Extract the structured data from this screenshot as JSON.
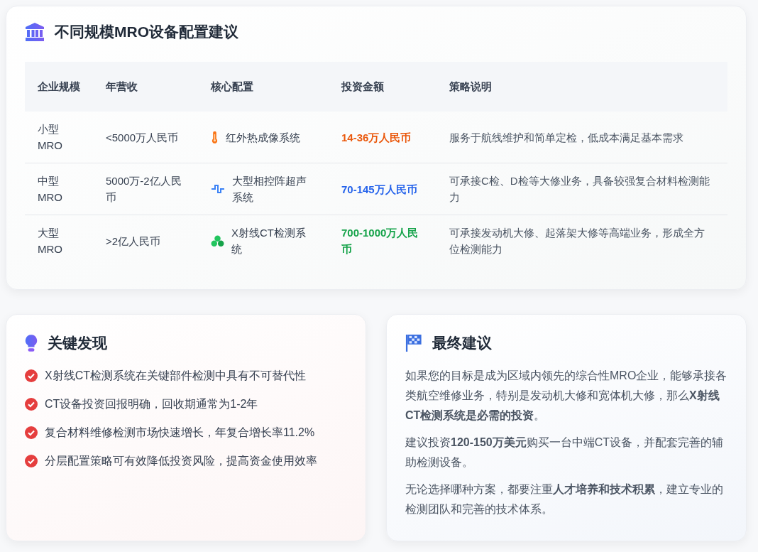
{
  "config_card": {
    "title": "不同规模MRO设备配置建议",
    "table": {
      "columns": [
        "企业规模",
        "年营收",
        "核心配置",
        "投资金额",
        "策略说明"
      ],
      "rows": [
        {
          "scale": "小型MRO",
          "revenue": "<5000万人民币",
          "config": "红外热成像系统",
          "amount": "14-36万人民币",
          "color": "#ea580c",
          "strategy": "服务于航线维护和简单定检，低成本满足基本需求"
        },
        {
          "scale": "中型MRO",
          "revenue": "5000万-2亿人民币",
          "config": "大型相控阵超声系统",
          "amount": "70-145万人民币",
          "color": "#2563eb",
          "strategy": "可承接C检、D检等大修业务，具备较强复合材料检测能力"
        },
        {
          "scale": "大型MRO",
          "revenue": ">2亿人民币",
          "config": "X射线CT检测系统",
          "amount": "700-1000万人民币",
          "color": "#16a34a",
          "strategy": "可承接发动机大修、起落架大修等高端业务，形成全方位检测能力"
        }
      ]
    }
  },
  "findings": {
    "title": "关键发现",
    "items": [
      "X射线CT检测系统在关键部件检测中具有不可替代性",
      "CT设备投资回报明确，回收期通常为1-2年",
      "复合材料维修检测市场快速增长，年复合增长率11.2%",
      "分层配置策略可有效降低投资风险，提高资金使用效率"
    ]
  },
  "recommendation": {
    "title": "最终建议",
    "paragraphs": [
      "如果您的目标是成为区域内领先的综合性MRO企业，能够承接各类航空维修业务，特别是发动机大修和宽体机大修，那么**X射线CT检测系统是必需的投资**。",
      "建议投资**120-150万美元**购买一台中端CT设备，并配套完善的辅助检测设备。",
      "无论选择哪种方案，都要注重**人才培养和技术积累**，建立专业的检测团队和完善的技术体系。"
    ]
  }
}
